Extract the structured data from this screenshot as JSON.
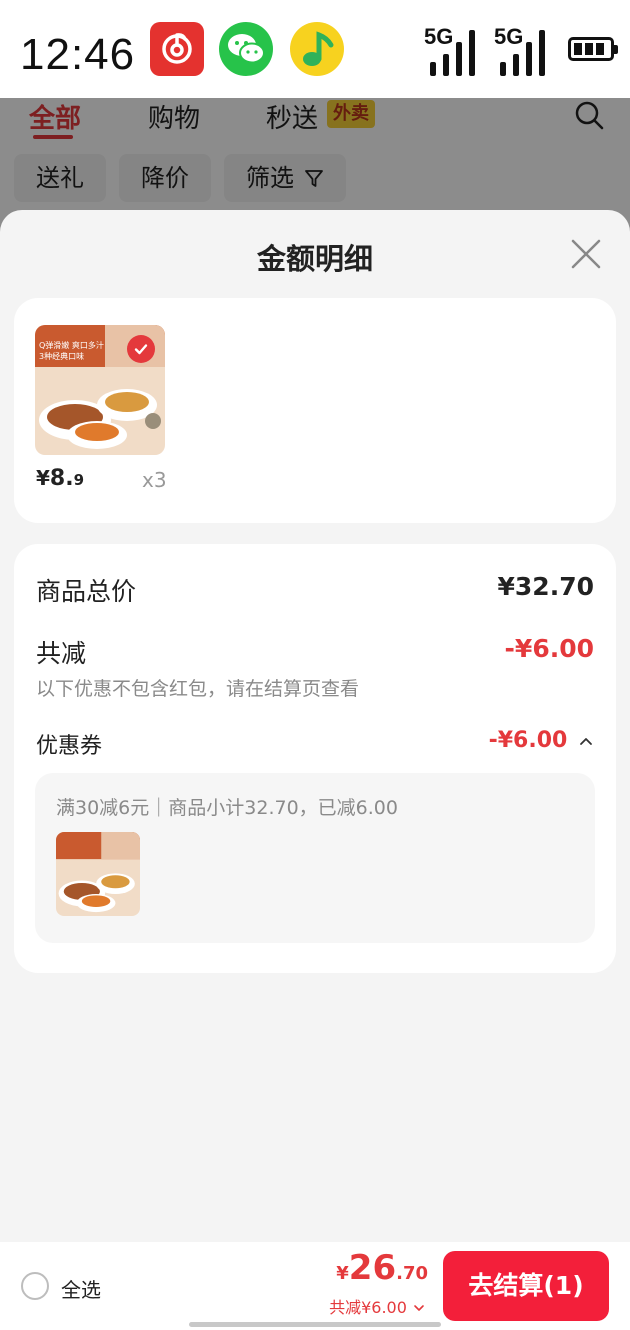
{
  "status_bar": {
    "time": "12:46",
    "signal_1": "5G",
    "signal_2": "5G",
    "app_icons": [
      "netease-music-icon",
      "wechat-icon",
      "qq-music-icon"
    ]
  },
  "background_page": {
    "tabs": [
      {
        "label": "全部",
        "active": true
      },
      {
        "label": "购物"
      },
      {
        "label": "秒送"
      }
    ],
    "waimai_tag": "外卖",
    "chips": [
      "送礼",
      "降价",
      "筛选"
    ]
  },
  "sheet": {
    "title": "金额明细",
    "product": {
      "thumb_caption_1": "Q弹滑嫩 爽口多汁",
      "thumb_caption_2": "3种经典口味",
      "price_currency": "¥",
      "price_int": "8.",
      "price_dec": "9",
      "quantity": "x3"
    },
    "summary": {
      "total_label": "商品总价",
      "total_value": "¥32.70",
      "discount_label": "共减",
      "discount_value": "-¥6.00",
      "note": "以下优惠不包含红包，请在结算页查看",
      "coupon_label": "优惠券",
      "coupon_value": "-¥6.00",
      "coupon_desc": "满30减6元｜商品小计32.70，已减6.00"
    }
  },
  "bottom_bar": {
    "select_all": "全选",
    "total_currency": "¥",
    "total_int": "26",
    "total_dec": ".70",
    "total_discount": "共减¥6.00",
    "checkout_label": "去结算(1)"
  },
  "colors": {
    "accent_red": "#e4393c",
    "checkout_red": "#f31f3a",
    "wechat_green": "#27c34a",
    "qqmusic_yellow": "#f7d21f"
  }
}
